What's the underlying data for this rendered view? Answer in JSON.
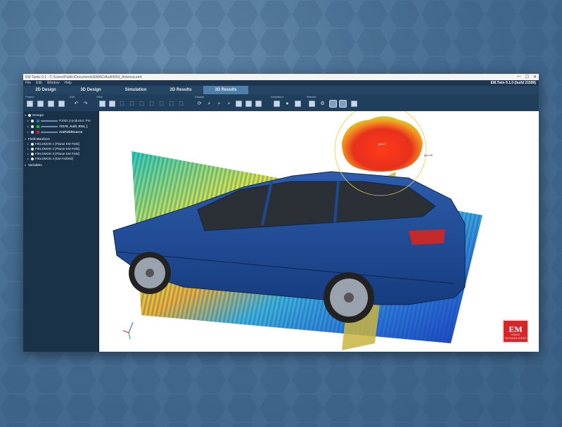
{
  "window": {
    "title": "EM.Tasks 9.1 - C:\\Users\\Public\\Documents\\EMAG\\Audi\\RS4_Antenna.emt",
    "controls": [
      "—",
      "☐",
      "✕"
    ]
  },
  "menu": {
    "items": [
      "File",
      "Edit",
      "Window",
      "Help"
    ],
    "app_name": "EM.Twin 9.1.0 (build 21599)"
  },
  "tabs": [
    {
      "label": "2D Design",
      "active": false
    },
    {
      "label": "3D Design",
      "active": false
    },
    {
      "label": "Simulation",
      "active": false
    },
    {
      "label": "2D Results",
      "active": false
    },
    {
      "label": "3D Results",
      "active": true
    }
  ],
  "toolbar": {
    "groups": [
      "Project",
      "Edit",
      "View",
      "Display",
      "Animation",
      "Results"
    ],
    "icons": [
      "open-project-icon",
      "save-project-icon",
      "save-as-icon",
      "export-icon",
      "undo-icon",
      "redo-icon",
      "view-3d-icon",
      "zoom-extents-icon",
      "view-front-icon",
      "view-back-icon",
      "view-left-icon",
      "view-right-icon",
      "view-top-icon",
      "view-bottom-icon",
      "view-iso-icon",
      "rotate-icon",
      "zoom-icon",
      "zoom-in-icon",
      "zoom-out-icon",
      "render-icon",
      "mesh-icon",
      "chart-icon",
      "animate-icon",
      "play-icon",
      "stop-icon",
      "plot-icon",
      "settings-icon",
      "field-icon",
      "palette-icon",
      "colorbar-icon"
    ]
  },
  "sidebar": {
    "groups_header": "Groups",
    "groups": [
      {
        "label": "PJ001 (conductor: Pre",
        "color": "#2f6fb5"
      },
      {
        "label": "72175_Audi_RS4_(",
        "color": "#1fb92a"
      },
      {
        "label": "AntFieldSource",
        "color": "#cf2020"
      }
    ],
    "monitors_header": "Field Monitors",
    "monitors": [
      {
        "label": "FIELDMON 1 [Planar EM Field]"
      },
      {
        "label": "FIELDMON 2 [Planar EM Field]"
      },
      {
        "label": "FIELDMON 3 [Planar EM Field]"
      },
      {
        "label": "FIELDMON 4 [EM Farfield]"
      }
    ],
    "variables_header": "Variables"
  },
  "viewport": {
    "pattern_label": "phi=0",
    "pattern_axis_label": "phi=90",
    "logo_text": "EM",
    "logo_sub": "EMAG TECHNOLOGIES"
  },
  "colors": {
    "accent": "#4f7ea8",
    "car_body": "#1e4a93",
    "logo": "#d4262b"
  }
}
